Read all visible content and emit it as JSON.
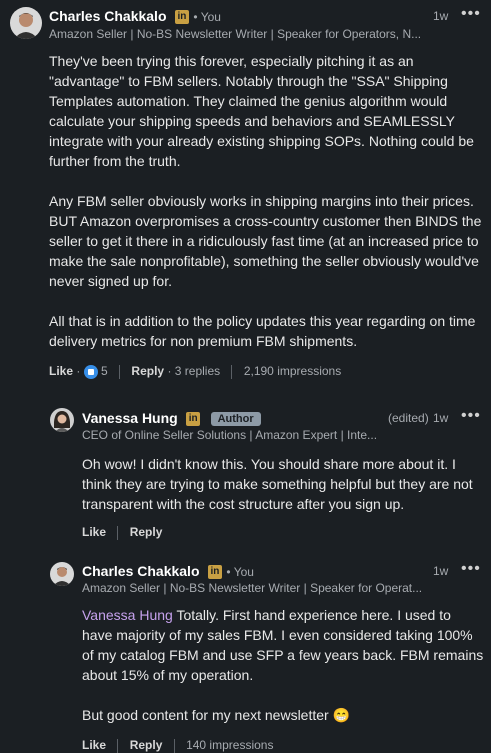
{
  "comment1": {
    "author": "Charles Chakkalo",
    "li_badge": "in",
    "you_label": "• You",
    "time": "1w",
    "headline": "Amazon Seller | No-BS Newsletter Writer | Speaker for Operators, N...",
    "paragraphs": [
      "They've been trying this forever, especially pitching it as an \"advantage\" to FBM sellers. Notably through the \"SSA\" Shipping Templates automation. They claimed the genius algorithm would calculate your shipping speeds and behaviors and SEAMLESSLY integrate with your already existing shipping SOPs. Nothing could be further from the truth.",
      "Any FBM seller obviously works in shipping margins into their prices. BUT Amazon overpromises a cross-country customer then BINDS the seller to get it there in a ridiculously fast time (at an increased price to make the sale nonprofitable), something the seller obviously would've never signed up for.",
      "All that is in addition to the policy updates this year regarding on time delivery metrics for non premium FBM shipments."
    ],
    "like_label": "Like",
    "like_dot": "·",
    "like_count": "5",
    "reply_label": "Reply",
    "replies": "· 3 replies",
    "impressions": "2,190 impressions"
  },
  "reply1": {
    "author": "Vanessa Hung",
    "li_badge": "in",
    "author_badge": "Author",
    "edited": "(edited)",
    "time": "1w",
    "headline": "CEO of Online Seller Solutions | Amazon Expert | Inte...",
    "text": "Oh wow! I didn't know this. You should share more about it. I think they are trying to make something helpful but they are not transparent with the cost structure after you sign up.",
    "like_label": "Like",
    "reply_label": "Reply"
  },
  "reply2": {
    "author": "Charles Chakkalo",
    "li_badge": "in",
    "you_label": "• You",
    "time": "1w",
    "headline": "Amazon Seller | No-BS Newsletter Writer | Speaker for Operat...",
    "mention": "Vanessa Hung",
    "text_after_mention": " Totally. First hand experience here. I used to have majority of my sales FBM. I even considered taking 100% of my catalog FBM and use SFP a few years back. FBM remains about 15% of my operation.",
    "text2": "But good content for my next newsletter 😁",
    "like_label": "Like",
    "reply_label": "Reply",
    "impressions": "140 impressions"
  },
  "more_icon": "•••"
}
